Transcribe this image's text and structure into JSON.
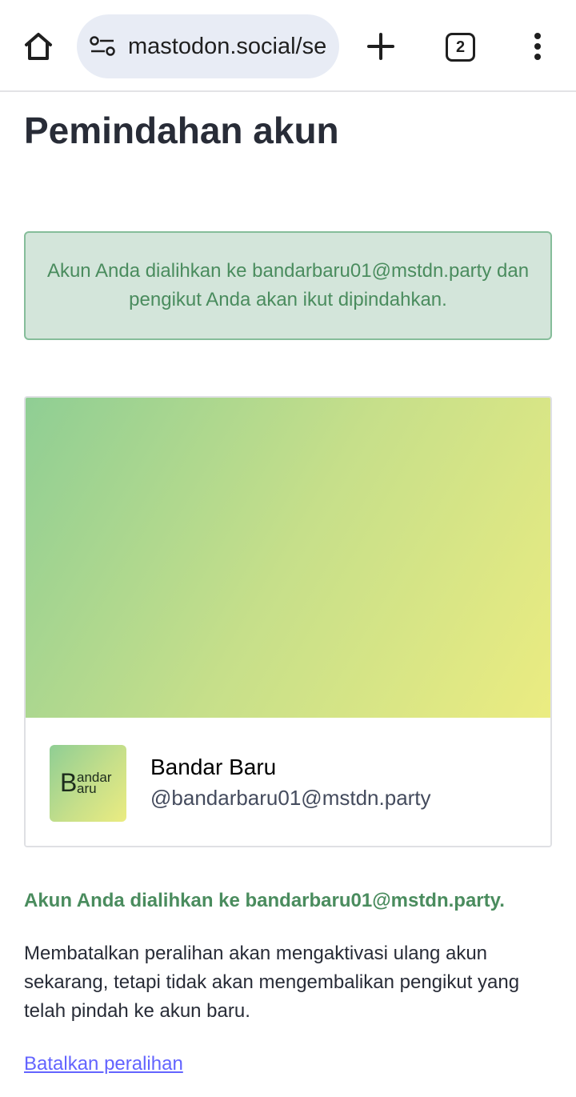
{
  "browser": {
    "url": "mastodon.social/settings/migration",
    "tab_count": "2",
    "icons": {
      "home": "home-icon",
      "site_settings": "tune-icon",
      "new_tab": "plus-icon",
      "tabs": "tab-switcher-icon",
      "menu": "more-vert-icon"
    }
  },
  "page": {
    "title": "Pemindahan akun",
    "notice": "Akun Anda dialihkan ke bandarbaru01@mstdn.party dan pengikut Anda akan ikut dipindahkan."
  },
  "card": {
    "display_name": "Bandar Baru",
    "handle": "@bandarbaru01@mstdn.party",
    "avatar_text": {
      "initial": "B",
      "line1": "andar",
      "line2": "aru"
    }
  },
  "details": {
    "status": "Akun Anda dialihkan ke bandarbaru01@mstdn.party.",
    "explanation": "Membatalkan peralihan akan mengaktivasi ulang akun sekarang, tetapi tidak akan mengembalikan pengikut yang telah pindah ke akun baru.",
    "cancel_link": "Batalkan peralihan"
  },
  "colors": {
    "notice_bg": "#d3e5da",
    "notice_border": "#85bd9a",
    "success_text": "#4a8c5e",
    "link": "#6364ff",
    "gradient_start": "#8fce94",
    "gradient_end": "#ebec81"
  }
}
